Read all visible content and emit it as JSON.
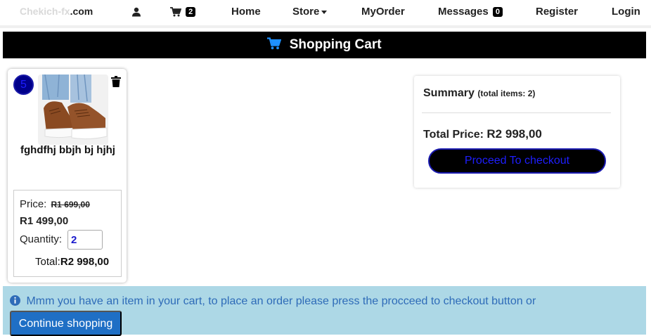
{
  "nav": {
    "brand_part1": "Chekich-fx",
    "brand_part2": ".com",
    "cart_count": "2",
    "home": "Home",
    "store": "Store",
    "myorder": "MyOrder",
    "messages": "Messages",
    "messages_count": "0",
    "register": "Register",
    "login": "Login",
    "icons": {
      "user": "user-icon",
      "cart": "cart-icon",
      "store_caret": "caret-down-icon"
    }
  },
  "header": {
    "title": "Shopping Cart",
    "icon": "cart-icon"
  },
  "product": {
    "quantity_badge": "5",
    "name": "fghdfhj bbjh bj hjhj",
    "price_label": "Price:",
    "old_price": "R1 699,00",
    "new_price": "R1 499,00",
    "quantity_label": "Quantity:",
    "quantity_value": "2",
    "total_label": "Total:",
    "total_value": "R2 998,00",
    "icons": {
      "delete": "trash-icon",
      "image": "sneaker-image"
    }
  },
  "summary": {
    "title": "Summary",
    "total_items": "(total items: 2)",
    "total_price_label": "Total Price:",
    "total_price_value": "R2 998,00",
    "checkout_button": "Proceed To checkout"
  },
  "info": {
    "message": "Mmm you have an item in your cart, to place an order please press the procceed to checkout button or",
    "continue_button": "Continue shopping",
    "icon": "info-icon"
  },
  "colors": {
    "header_bg": "#000000",
    "info_bg": "#add8e6",
    "info_text": "#2e6bb8",
    "continue_btn": "#1f6fc5",
    "checkout_text": "#1e1eff"
  }
}
